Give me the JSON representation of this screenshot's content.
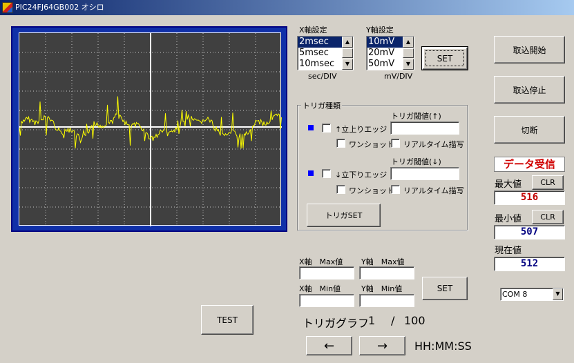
{
  "window": {
    "title": "PIC24FJ64GB002 オシロ",
    "icon": "app-icon"
  },
  "xaxis": {
    "label": "X軸設定",
    "options": [
      "2msec",
      "5msec",
      "10msec"
    ],
    "selected": "2msec",
    "unit": "sec/DIV"
  },
  "yaxis": {
    "label": "Y軸設定",
    "options": [
      "10mV",
      "20mV",
      "50mV"
    ],
    "selected": "10mV",
    "unit": "mV/DIV"
  },
  "set_label": "SET",
  "trigger": {
    "group_title": "トリガ種類",
    "rise_label": "↑立上りエッジ",
    "rise_threshold_label": "トリガ閾値(↑)",
    "rise_threshold_value": "",
    "fall_label": "↓立下りエッジ",
    "fall_threshold_label": "トリガ閾値(↓)",
    "fall_threshold_value": "",
    "oneshot_label": "ワンショット",
    "realtime_label": "リアルタイム描写",
    "set_label": "トリガSET"
  },
  "right_panel": {
    "start_label": "取込開始",
    "stop_label": "取込停止",
    "disconnect_label": "切断",
    "status_text": "データ受信",
    "status_color": "#d00000",
    "max_label": "最大値",
    "max_value": "516",
    "min_label": "最小値",
    "min_value": "507",
    "current_label": "現在値",
    "current_value": "512",
    "clr_label": "CLR",
    "com_selected": "COM 8"
  },
  "range": {
    "x_max_label": "X軸　Max値",
    "y_max_label": "Y軸　Max値",
    "x_min_label": "X軸　Min値",
    "y_min_label": "Y軸　Min値",
    "x_max_value": "",
    "y_max_value": "",
    "x_min_value": "",
    "y_min_value": "",
    "set_label": "SET"
  },
  "bottom": {
    "test_label": "TEST",
    "trigger_graph_label": "トリガグラフ",
    "page_current": "1",
    "page_sep": "/",
    "page_total": "100",
    "prev_label": "←",
    "next_label": "→",
    "time_label": "HH:MM:SS"
  },
  "colors": {
    "trace": "#ffff00",
    "scope_bg": "#404040",
    "scope_frame": "#1030a8",
    "grid": "#c8c8c8"
  }
}
